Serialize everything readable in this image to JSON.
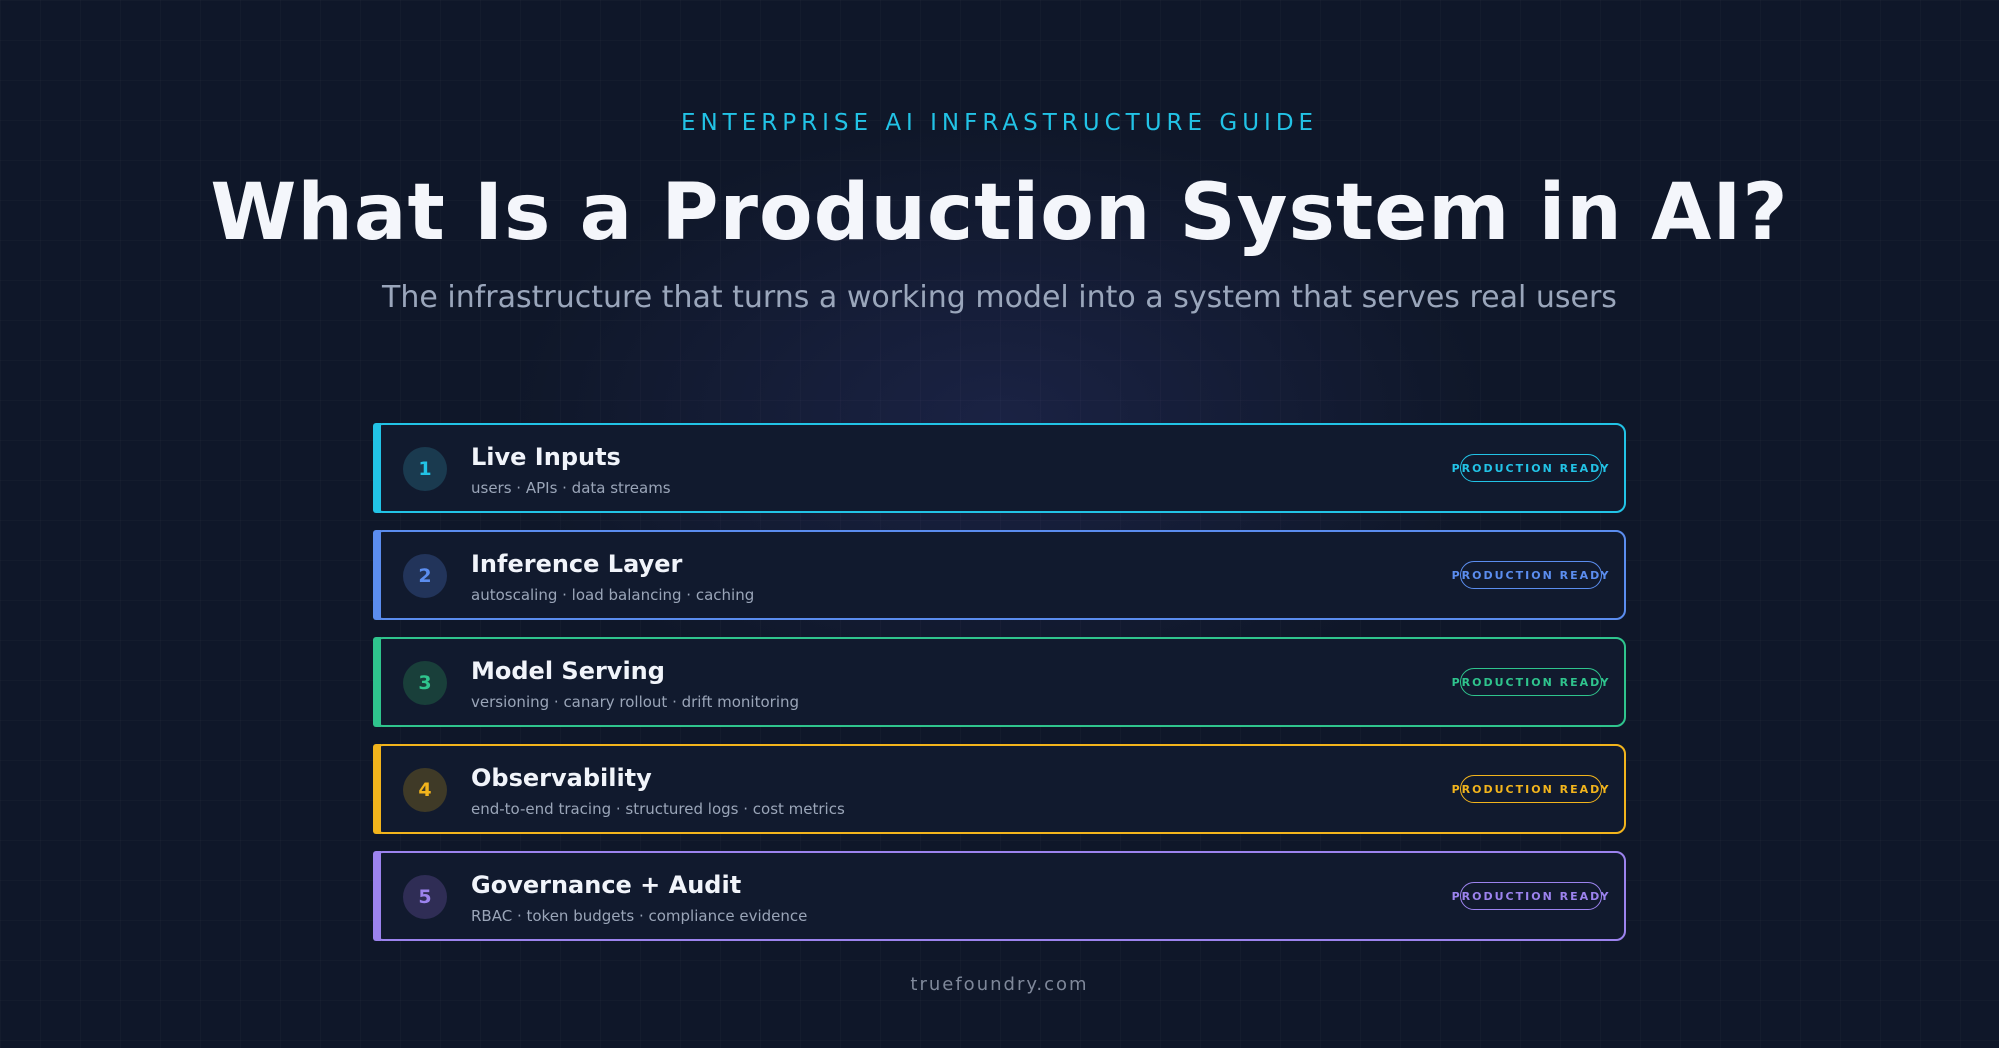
{
  "header": {
    "eyebrow": "ENTERPRISE AI INFRASTRUCTURE GUIDE",
    "title": "What Is a Production System in AI?",
    "subtitle": "The infrastructure that turns a working model into a system that serves real users"
  },
  "layers": [
    {
      "number": "1",
      "name": "Live Inputs",
      "details": "users · APIs · data streams",
      "badge": "PRODUCTION READY",
      "color": "#22c3e6",
      "number_bg": "#1a3a4f"
    },
    {
      "number": "2",
      "name": "Inference Layer",
      "details": "autoscaling · load balancing · caching",
      "badge": "PRODUCTION READY",
      "color": "#5b8def",
      "number_bg": "#22345a"
    },
    {
      "number": "3",
      "name": "Model Serving",
      "details": "versioning · canary rollout · drift monitoring",
      "badge": "PRODUCTION READY",
      "color": "#2fc48d",
      "number_bg": "#193f3a"
    },
    {
      "number": "4",
      "name": "Observability",
      "details": "end-to-end tracing · structured logs · cost metrics",
      "badge": "PRODUCTION READY",
      "color": "#f2b41c",
      "number_bg": "#3f3a27"
    },
    {
      "number": "5",
      "name": "Governance + Audit",
      "details": "RBAC · token budgets · compliance evidence",
      "badge": "PRODUCTION READY",
      "color": "#9c83ee",
      "number_bg": "#2f2d55"
    }
  ],
  "footer": {
    "site": "truefoundry.com"
  }
}
